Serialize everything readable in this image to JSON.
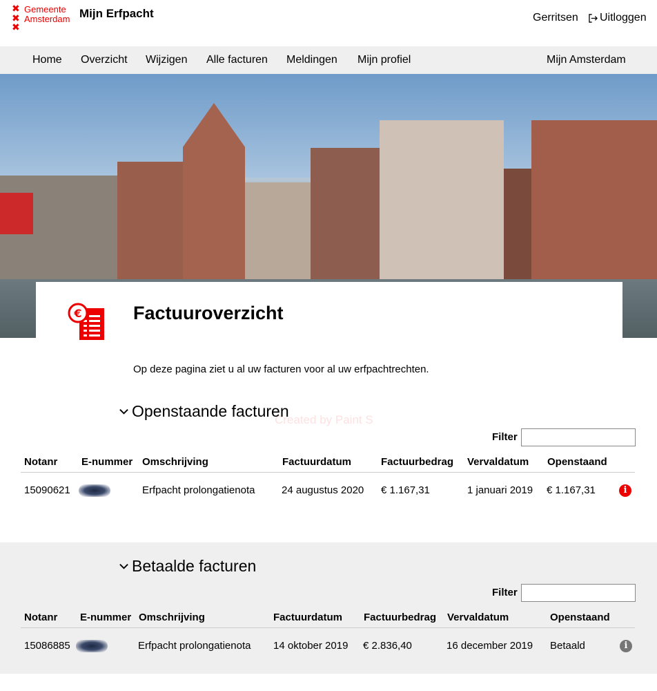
{
  "header": {
    "logo_line1": "Gemeente",
    "logo_line2": "Amsterdam",
    "app_title": "Mijn Erfpacht",
    "user_name": "Gerritsen",
    "logout_label": "Uitloggen"
  },
  "nav": {
    "items": [
      "Home",
      "Overzicht",
      "Wijzigen",
      "Alle facturen",
      "Meldingen",
      "Mijn profiel"
    ],
    "right_item": "Mijn Amsterdam"
  },
  "page": {
    "title": "Factuuroverzicht",
    "intro": "Op deze pagina ziet u al uw facturen voor al uw erfpachtrechten.",
    "watermark": "Created by Paint S"
  },
  "open_section": {
    "title": "Openstaande facturen",
    "filter_label": "Filter",
    "filter_value": "",
    "columns": [
      "Notanr",
      "E-nummer",
      "Omschrijving",
      "Factuurdatum",
      "Factuurbedrag",
      "Vervaldatum",
      "Openstaand"
    ],
    "rows": [
      {
        "notanr": "15090621",
        "enummer": "",
        "omschrijving": "Erfpacht prolongatienota",
        "factuurdatum": "24 augustus 2020",
        "factuurbedrag": "€ 1.167,31",
        "vervaldatum": "1 januari 2019",
        "openstaand": "€ 1.167,31",
        "status_icon": "info-red-icon"
      }
    ]
  },
  "paid_section": {
    "title": "Betaalde facturen",
    "filter_label": "Filter",
    "filter_value": "",
    "columns": [
      "Notanr",
      "E-nummer",
      "Omschrijving",
      "Factuurdatum",
      "Factuurbedrag",
      "Vervaldatum",
      "Openstaand"
    ],
    "rows": [
      {
        "notanr": "15086885",
        "enummer": "",
        "omschrijving": "Erfpacht prolongatienota",
        "factuurdatum": "14 oktober 2019",
        "factuurbedrag": "€ 2.836,40",
        "vervaldatum": "16 december 2019",
        "openstaand": "Betaald",
        "status_icon": "info-grey-icon"
      }
    ]
  },
  "colors": {
    "brand_red": "#ec0000",
    "nav_bg": "#efefef",
    "info_grey": "#767676"
  }
}
